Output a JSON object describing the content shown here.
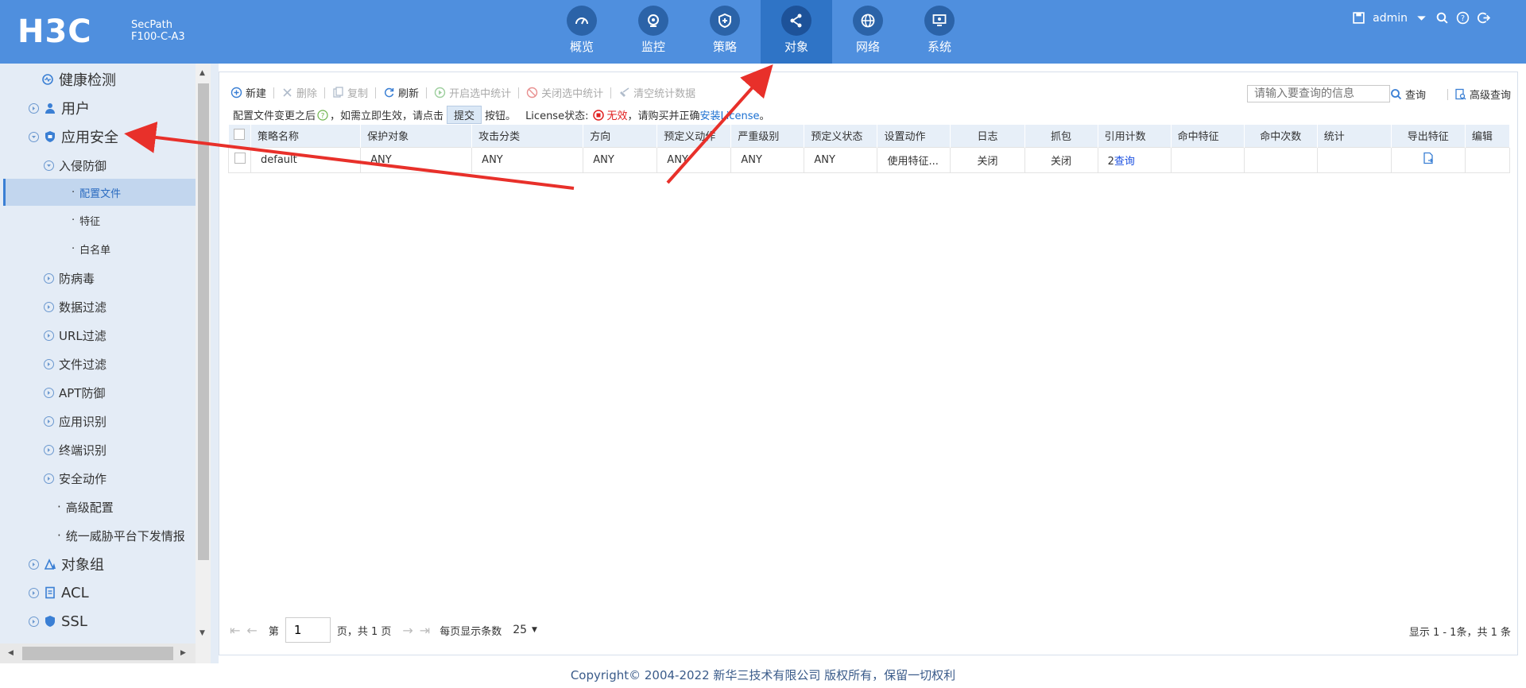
{
  "header": {
    "logo": "H3C",
    "product_line1": "SecPath",
    "product_line2": "F100-C-A3",
    "nav": [
      {
        "label": "概览",
        "icon": "gauge-icon"
      },
      {
        "label": "监控",
        "icon": "camera-icon"
      },
      {
        "label": "策略",
        "icon": "shield-icon"
      },
      {
        "label": "对象",
        "icon": "share-nodes-icon",
        "active": true
      },
      {
        "label": "网络",
        "icon": "globe-icon"
      },
      {
        "label": "系统",
        "icon": "monitor-icon"
      }
    ],
    "user": "admin"
  },
  "sidebar": {
    "items": [
      {
        "label": "健康检测"
      },
      {
        "label": "用户"
      },
      {
        "label": "应用安全"
      },
      {
        "label": "入侵防御"
      },
      {
        "label": "配置文件"
      },
      {
        "label": "特征"
      },
      {
        "label": "白名单"
      },
      {
        "label": "防病毒"
      },
      {
        "label": "数据过滤"
      },
      {
        "label": "URL过滤"
      },
      {
        "label": "文件过滤"
      },
      {
        "label": "APT防御"
      },
      {
        "label": "应用识别"
      },
      {
        "label": "终端识别"
      },
      {
        "label": "安全动作"
      },
      {
        "label": "高级配置"
      },
      {
        "label": "统一威胁平台下发情报"
      },
      {
        "label": "对象组"
      },
      {
        "label": "ACL"
      },
      {
        "label": "SSL"
      }
    ]
  },
  "toolbar": {
    "new": "新建",
    "delete": "删除",
    "copy": "复制",
    "refresh": "刷新",
    "enable_stats": "开启选中统计",
    "disable_stats": "关闭选中统计",
    "clear_stats": "清空统计数据",
    "search_placeholder": "请输入要查询的信息",
    "search": "查询",
    "advanced_search": "高级查询"
  },
  "notice": {
    "text1": "配置文件变更之后",
    "text2": "，如需立即生效，请点击",
    "submit": "提交",
    "text3": "按钮。",
    "license_label": "License状态:",
    "license_status": "无效",
    "text4": "，请购买并正确",
    "install_link": "安装License",
    "text5": "。"
  },
  "table": {
    "columns": [
      "策略名称",
      "保护对象",
      "攻击分类",
      "方向",
      "预定义动作",
      "严重级别",
      "预定义状态",
      "设置动作",
      "日志",
      "抓包",
      "引用计数",
      "命中特征",
      "命中次数",
      "统计",
      "导出特征",
      "编辑"
    ],
    "rows": [
      {
        "name": "default",
        "protect": "ANY",
        "attack": "ANY",
        "direction": "ANY",
        "predef_action": "ANY",
        "severity": "ANY",
        "predef_state": "ANY",
        "set_action": "使用特征...",
        "log": "关闭",
        "capture": "关闭",
        "ref_count": "2",
        "ref_link": "查询",
        "hit_feature": "",
        "hit_count": "",
        "stats": ""
      }
    ]
  },
  "pager": {
    "page_prefix": "第",
    "page": "1",
    "page_suffix": "页，共 1 页",
    "per_page_label": "每页显示条数",
    "per_page": "25",
    "summary": "显示 1 - 1条，共 1 条"
  },
  "footer": "Copyright© 2004-2022 新华三技术有限公司 版权所有，保留一切权利",
  "colors": {
    "header_bg": "#4f8fde",
    "nav_active": "#2f74c6",
    "sidebar_bg": "#e4ecf6",
    "link": "#1a6fd1",
    "danger": "#e02020",
    "arrow": "#e8302a"
  }
}
